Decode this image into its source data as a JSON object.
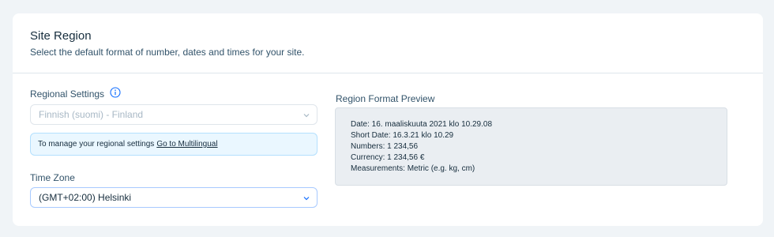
{
  "header": {
    "title": "Site Region",
    "subtitle": "Select the default format of number, dates and times for your site."
  },
  "regional": {
    "label": "Regional Settings",
    "selected": "Finnish (suomi) - Finland",
    "notice_text": "To manage your regional settings",
    "notice_link": "Go to Multilingual"
  },
  "timezone": {
    "label": "Time Zone",
    "selected": "(GMT+02:00) Helsinki"
  },
  "preview": {
    "label": "Region Format Preview",
    "lines": {
      "date": "Date: 16. maaliskuuta 2021 klo 10.29.08",
      "short_date": "Short Date: 16.3.21 klo 10.29",
      "numbers": "Numbers: 1 234,56",
      "currency": "Currency: 1 234,56 €",
      "measurements": "Measurements: Metric (e.g. kg, cm)"
    }
  },
  "icons": {
    "info": "info-icon",
    "chevron": "chevron-down-icon"
  },
  "colors": {
    "accent": "#116dff",
    "background": "#f0f4f7",
    "notice_bg": "#eaf7ff",
    "preview_bg": "#eaeef2"
  }
}
